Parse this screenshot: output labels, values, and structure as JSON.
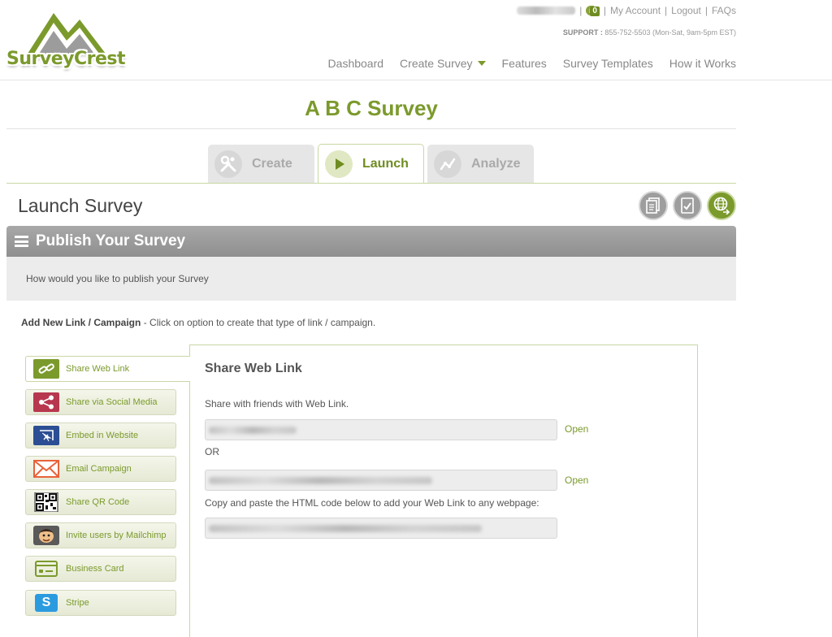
{
  "brand": {
    "name": "SurveyCrest",
    "color": "#7b9a2c"
  },
  "topbar": {
    "badge_count": "0",
    "my_account": "My Account",
    "logout": "Logout",
    "faqs": "FAQs"
  },
  "support": {
    "label": "SUPPORT :",
    "phone": "855-752-5503 (Mon-Sat, 9am-5pm EST)"
  },
  "nav": [
    "Dashboard",
    "Create Survey",
    "Features",
    "Survey Templates",
    "How it Works"
  ],
  "survey": {
    "title": "A B C Survey"
  },
  "tabs": [
    {
      "label": "Create",
      "icon": "tools-icon",
      "active": false
    },
    {
      "label": "Launch",
      "icon": "play-icon",
      "active": true
    },
    {
      "label": "Analyze",
      "icon": "chart-line-icon",
      "active": false
    }
  ],
  "page": {
    "title": "Launch Survey"
  },
  "publish": {
    "title": "Publish Your Survey",
    "subtitle": "How would you like to publish your Survey"
  },
  "add_new": {
    "label": "Add New Link / Campaign",
    "hint": "- Click on option to create that type of link / campaign."
  },
  "options": [
    {
      "label": "Share Web Link",
      "icon": "link-icon",
      "active": true
    },
    {
      "label": "Share via Social Media",
      "icon": "share-icon"
    },
    {
      "label": "Embed in Website",
      "icon": "embed-icon"
    },
    {
      "label": "Email Campaign",
      "icon": "envelope-icon"
    },
    {
      "label": "Share QR Code",
      "icon": "qr-code-icon"
    },
    {
      "label": "Invite users by Mailchimp",
      "icon": "mailchimp-icon"
    },
    {
      "label": "Business Card",
      "icon": "business-card-icon"
    },
    {
      "label": "Stripe",
      "icon": "stripe-icon"
    }
  ],
  "panel": {
    "title": "Share Web Link",
    "share_text": "Share with friends with Web Link.",
    "or_text": "OR",
    "open_label": "Open",
    "copy_text": "Copy and paste the HTML code below to add your Web Link to any webpage:"
  }
}
